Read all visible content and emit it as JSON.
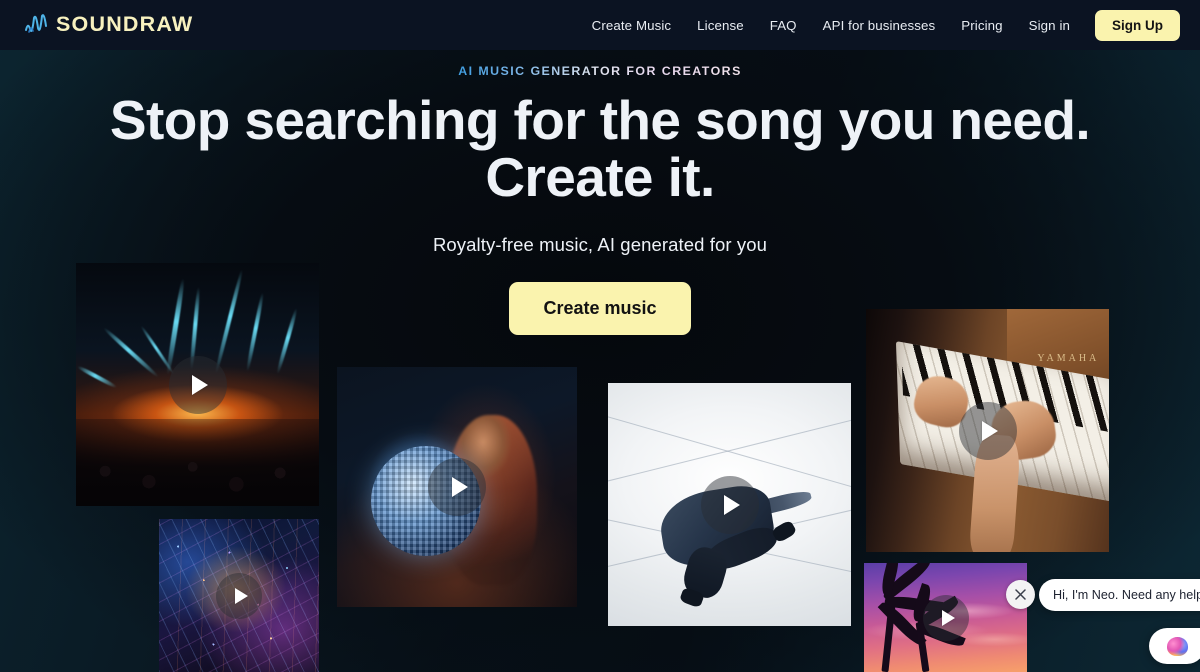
{
  "header": {
    "logo_text": "SOUNDRAW",
    "logo_mark_icon": "waveform-icon",
    "nav": [
      {
        "label": "Create Music",
        "name": "nav-create-music"
      },
      {
        "label": "License",
        "name": "nav-license"
      },
      {
        "label": "FAQ",
        "name": "nav-faq"
      },
      {
        "label": "API for businesses",
        "name": "nav-api-for-businesses"
      },
      {
        "label": "Pricing",
        "name": "nav-pricing"
      },
      {
        "label": "Sign in",
        "name": "nav-sign-in"
      }
    ],
    "signup_label": "Sign Up",
    "accent_color": "#faf3ae",
    "background_color": "#0b1322"
  },
  "hero": {
    "eyebrow": "AI MUSIC GENERATOR FOR CREATORS",
    "headline_line1": "Stop searching for the song you need.",
    "headline_line2": "Create it.",
    "subheadline": "Royalty-free music, AI generated for you",
    "cta_label": "Create music",
    "cta_color": "#faf3ae"
  },
  "cards": [
    {
      "name": "video-card-concert",
      "alt": "Concert stage with blue laser beams over a crowd",
      "play_icon": "play-icon"
    },
    {
      "name": "video-card-city",
      "alt": "Aerial night view of a neon-lit city",
      "play_icon": "play-icon"
    },
    {
      "name": "video-card-disco",
      "alt": "Woman holding a mirrored disco ball",
      "play_icon": "play-icon"
    },
    {
      "name": "video-card-dancer",
      "alt": "Breakdancer mid-move in a bright white corridor",
      "play_icon": "play-icon"
    },
    {
      "name": "video-card-piano",
      "alt": "Hands playing a wooden Yamaha upright piano",
      "play_icon": "play-icon"
    },
    {
      "name": "video-card-palms",
      "alt": "Palm tree silhouettes against a purple sunset sky",
      "play_icon": "play-icon"
    }
  ],
  "chat": {
    "message": "Hi, I'm Neo. Need any help?",
    "close_icon": "close-icon",
    "avatar_icon": "brain-icon"
  },
  "piano_brand": "YAMAHA"
}
